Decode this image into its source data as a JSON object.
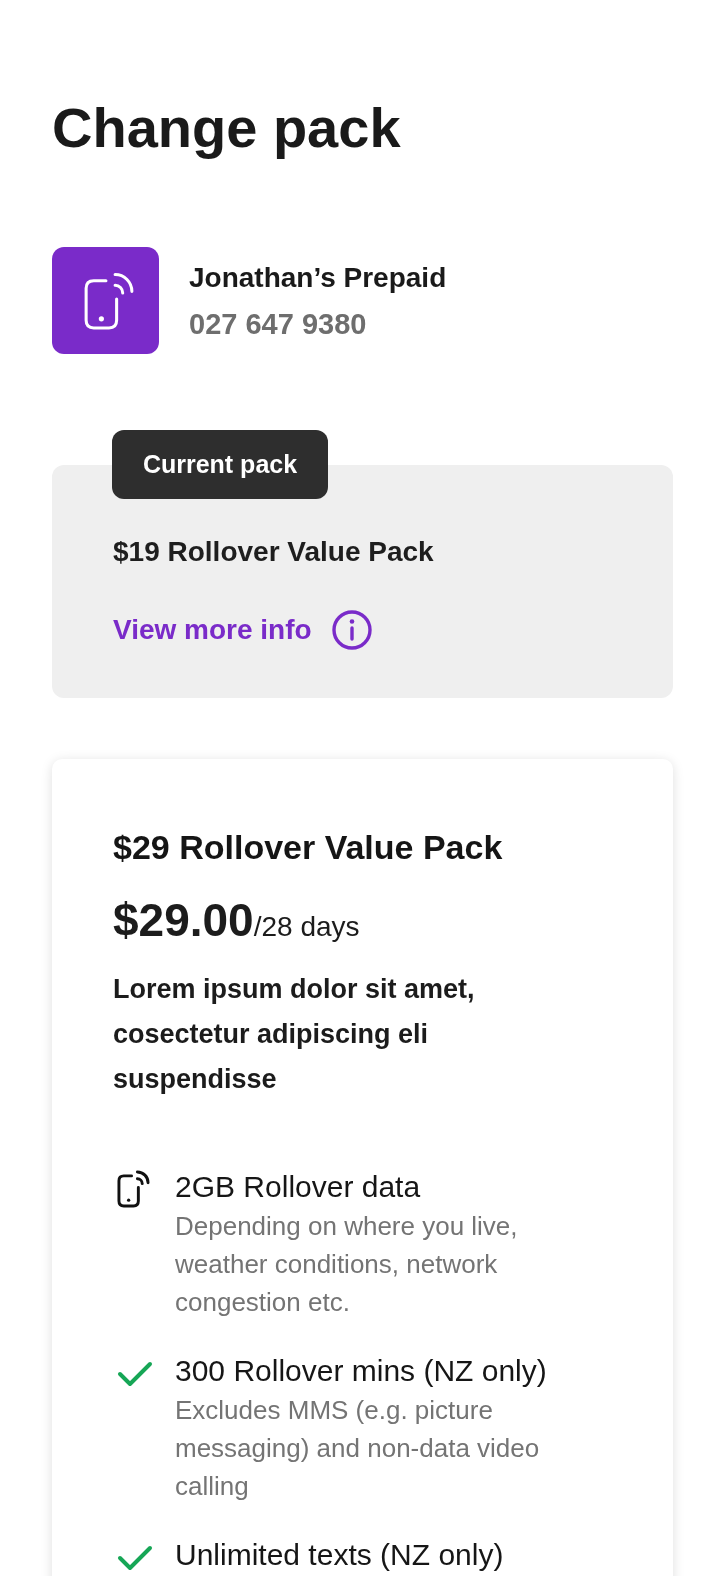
{
  "page": {
    "title": "Change pack"
  },
  "account": {
    "name": "Jonathan’s Prepaid",
    "number": "027 647 9380"
  },
  "current_pack": {
    "badge": "Current pack",
    "name": "$19 Rollover Value Pack",
    "link": "View more info"
  },
  "offer": {
    "name": "$29 Rollover Value Pack",
    "price": "$29.00",
    "period": "/28 days",
    "description": "Lorem ipsum dolor sit amet, cosectetur adipiscing eli suspendisse",
    "features": [
      {
        "kind": "data",
        "title": "2GB Rollover data",
        "note": "Depending on where you live, weather conditions, network congestion etc."
      },
      {
        "kind": "included",
        "title": "300 Rollover mins (NZ only)",
        "note": "Excludes MMS (e.g. picture messaging) and non-data video calling"
      },
      {
        "kind": "included",
        "title": "Unlimited texts (NZ only)"
      }
    ]
  }
}
